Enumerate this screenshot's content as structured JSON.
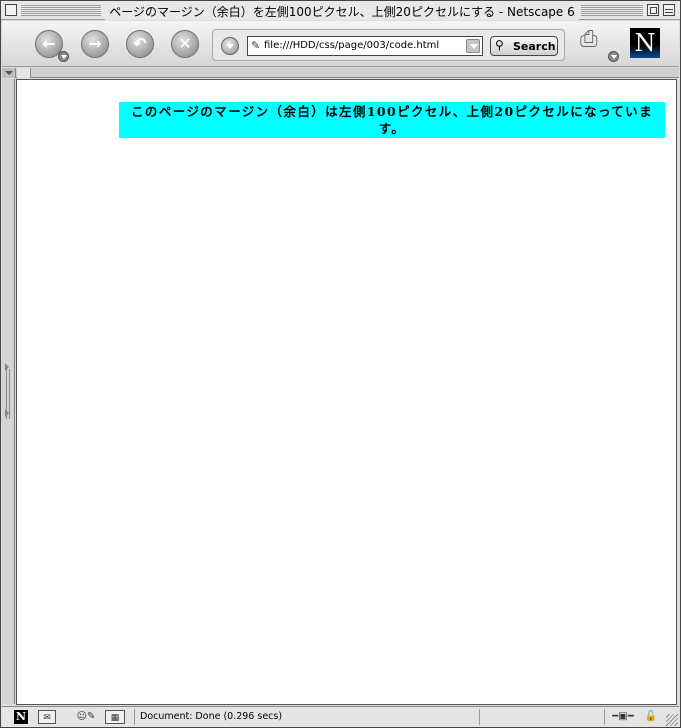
{
  "window": {
    "title": "ページのマージン（余白）を左側100ピクセル、上側20ピクセルにする - Netscape 6"
  },
  "toolbar": {
    "url": "file:///HDD/css/page/003/code.html",
    "search_label": "Search",
    "logo_letter": "N"
  },
  "icons": {
    "back": "back-arrow-icon",
    "forward": "forward-arrow-icon",
    "reload": "reload-icon",
    "stop": "stop-icon",
    "print": "print-icon",
    "search": "magnifier-icon"
  },
  "page": {
    "banner_text": "このページのマージン（余白）は左側100ピクセル、上側20ピクセルになっています。",
    "banner_bg": "#00ffff"
  },
  "statusbar": {
    "text": "Document: Done (0.296 secs)",
    "n_letter": "N"
  }
}
